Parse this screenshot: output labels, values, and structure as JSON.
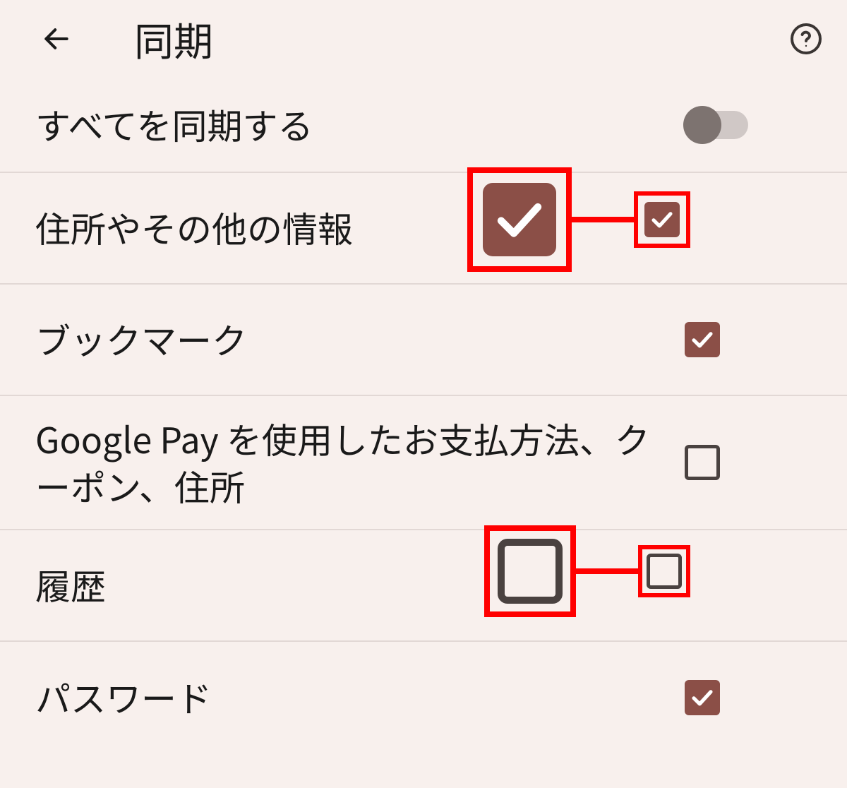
{
  "header": {
    "title": "同期"
  },
  "toggle_row": {
    "label": "すべてを同期する",
    "state": "off"
  },
  "items": [
    {
      "label": "住所やその他の情報",
      "checked": true,
      "annotated": true
    },
    {
      "label": "ブックマーク",
      "checked": true,
      "annotated": false
    },
    {
      "label": "Google Pay を使用したお支払方法、クーポン、住所",
      "checked": false,
      "annotated": false
    },
    {
      "label": "履歴",
      "checked": false,
      "annotated": true
    },
    {
      "label": "パスワード",
      "checked": true,
      "annotated": false
    }
  ],
  "colors": {
    "background": "#f8f0ed",
    "checkbox_checked": "#8b4f47",
    "annotation": "#ff0000"
  }
}
